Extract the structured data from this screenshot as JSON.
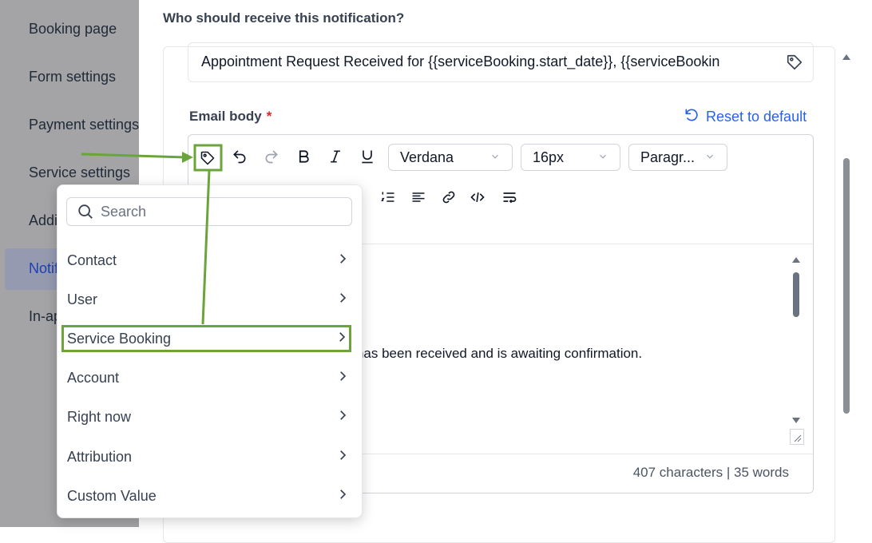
{
  "sidebar": {
    "items": [
      {
        "label": "Booking page"
      },
      {
        "label": "Form settings"
      },
      {
        "label": "Payment settings"
      },
      {
        "label": "Service settings"
      },
      {
        "label": "Addi"
      },
      {
        "label": "Notif"
      },
      {
        "label": "In-ap"
      }
    ]
  },
  "main": {
    "question": "Who should receive this notification?",
    "subject": "Appointment Request Received for {{serviceBooking.start_date}}, {{serviceBookin",
    "email_label": "Email body",
    "required_mark": "*",
    "reset_label": "Reset to default",
    "toolbar": {
      "font": "Verdana",
      "size": "16px",
      "block": "Paragr..."
    },
    "body_text": "st has been received and is awaiting confirmation.",
    "counter": "407 characters | 35 words"
  },
  "popup": {
    "search_placeholder": "Search",
    "items": [
      {
        "label": "Contact"
      },
      {
        "label": "User"
      },
      {
        "label": "Service Booking"
      },
      {
        "label": "Account"
      },
      {
        "label": "Right now"
      },
      {
        "label": "Attribution"
      },
      {
        "label": "Custom Value"
      }
    ]
  },
  "colors": {
    "accent": "#2563eb",
    "annotation": "#6aa43a",
    "required": "#dc2626"
  }
}
